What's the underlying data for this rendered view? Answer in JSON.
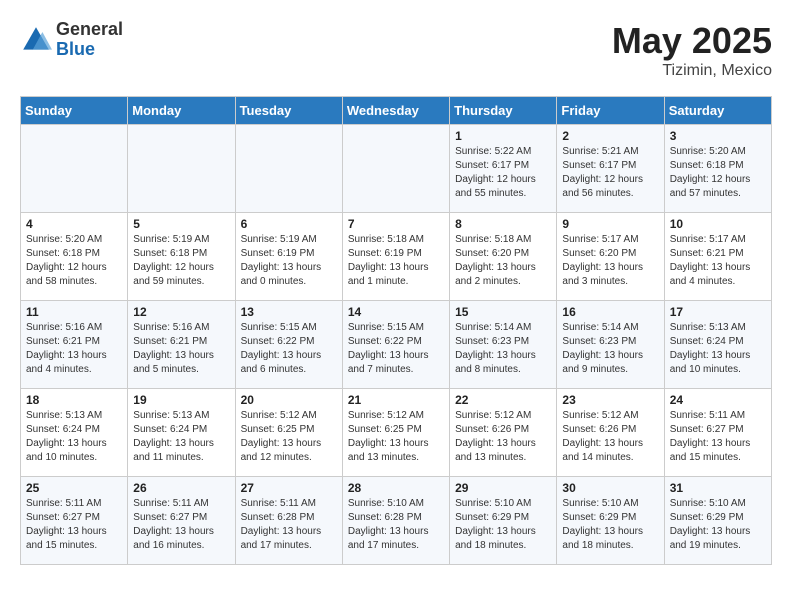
{
  "logo": {
    "general": "General",
    "blue": "Blue"
  },
  "title": "May 2025",
  "subtitle": "Tizimin, Mexico",
  "days_of_week": [
    "Sunday",
    "Monday",
    "Tuesday",
    "Wednesday",
    "Thursday",
    "Friday",
    "Saturday"
  ],
  "weeks": [
    [
      {
        "day": "",
        "info": ""
      },
      {
        "day": "",
        "info": ""
      },
      {
        "day": "",
        "info": ""
      },
      {
        "day": "",
        "info": ""
      },
      {
        "day": "1",
        "info": "Sunrise: 5:22 AM\nSunset: 6:17 PM\nDaylight: 12 hours\nand 55 minutes."
      },
      {
        "day": "2",
        "info": "Sunrise: 5:21 AM\nSunset: 6:17 PM\nDaylight: 12 hours\nand 56 minutes."
      },
      {
        "day": "3",
        "info": "Sunrise: 5:20 AM\nSunset: 6:18 PM\nDaylight: 12 hours\nand 57 minutes."
      }
    ],
    [
      {
        "day": "4",
        "info": "Sunrise: 5:20 AM\nSunset: 6:18 PM\nDaylight: 12 hours\nand 58 minutes."
      },
      {
        "day": "5",
        "info": "Sunrise: 5:19 AM\nSunset: 6:18 PM\nDaylight: 12 hours\nand 59 minutes."
      },
      {
        "day": "6",
        "info": "Sunrise: 5:19 AM\nSunset: 6:19 PM\nDaylight: 13 hours\nand 0 minutes."
      },
      {
        "day": "7",
        "info": "Sunrise: 5:18 AM\nSunset: 6:19 PM\nDaylight: 13 hours\nand 1 minute."
      },
      {
        "day": "8",
        "info": "Sunrise: 5:18 AM\nSunset: 6:20 PM\nDaylight: 13 hours\nand 2 minutes."
      },
      {
        "day": "9",
        "info": "Sunrise: 5:17 AM\nSunset: 6:20 PM\nDaylight: 13 hours\nand 3 minutes."
      },
      {
        "day": "10",
        "info": "Sunrise: 5:17 AM\nSunset: 6:21 PM\nDaylight: 13 hours\nand 4 minutes."
      }
    ],
    [
      {
        "day": "11",
        "info": "Sunrise: 5:16 AM\nSunset: 6:21 PM\nDaylight: 13 hours\nand 4 minutes."
      },
      {
        "day": "12",
        "info": "Sunrise: 5:16 AM\nSunset: 6:21 PM\nDaylight: 13 hours\nand 5 minutes."
      },
      {
        "day": "13",
        "info": "Sunrise: 5:15 AM\nSunset: 6:22 PM\nDaylight: 13 hours\nand 6 minutes."
      },
      {
        "day": "14",
        "info": "Sunrise: 5:15 AM\nSunset: 6:22 PM\nDaylight: 13 hours\nand 7 minutes."
      },
      {
        "day": "15",
        "info": "Sunrise: 5:14 AM\nSunset: 6:23 PM\nDaylight: 13 hours\nand 8 minutes."
      },
      {
        "day": "16",
        "info": "Sunrise: 5:14 AM\nSunset: 6:23 PM\nDaylight: 13 hours\nand 9 minutes."
      },
      {
        "day": "17",
        "info": "Sunrise: 5:13 AM\nSunset: 6:24 PM\nDaylight: 13 hours\nand 10 minutes."
      }
    ],
    [
      {
        "day": "18",
        "info": "Sunrise: 5:13 AM\nSunset: 6:24 PM\nDaylight: 13 hours\nand 10 minutes."
      },
      {
        "day": "19",
        "info": "Sunrise: 5:13 AM\nSunset: 6:24 PM\nDaylight: 13 hours\nand 11 minutes."
      },
      {
        "day": "20",
        "info": "Sunrise: 5:12 AM\nSunset: 6:25 PM\nDaylight: 13 hours\nand 12 minutes."
      },
      {
        "day": "21",
        "info": "Sunrise: 5:12 AM\nSunset: 6:25 PM\nDaylight: 13 hours\nand 13 minutes."
      },
      {
        "day": "22",
        "info": "Sunrise: 5:12 AM\nSunset: 6:26 PM\nDaylight: 13 hours\nand 13 minutes."
      },
      {
        "day": "23",
        "info": "Sunrise: 5:12 AM\nSunset: 6:26 PM\nDaylight: 13 hours\nand 14 minutes."
      },
      {
        "day": "24",
        "info": "Sunrise: 5:11 AM\nSunset: 6:27 PM\nDaylight: 13 hours\nand 15 minutes."
      }
    ],
    [
      {
        "day": "25",
        "info": "Sunrise: 5:11 AM\nSunset: 6:27 PM\nDaylight: 13 hours\nand 15 minutes."
      },
      {
        "day": "26",
        "info": "Sunrise: 5:11 AM\nSunset: 6:27 PM\nDaylight: 13 hours\nand 16 minutes."
      },
      {
        "day": "27",
        "info": "Sunrise: 5:11 AM\nSunset: 6:28 PM\nDaylight: 13 hours\nand 17 minutes."
      },
      {
        "day": "28",
        "info": "Sunrise: 5:10 AM\nSunset: 6:28 PM\nDaylight: 13 hours\nand 17 minutes."
      },
      {
        "day": "29",
        "info": "Sunrise: 5:10 AM\nSunset: 6:29 PM\nDaylight: 13 hours\nand 18 minutes."
      },
      {
        "day": "30",
        "info": "Sunrise: 5:10 AM\nSunset: 6:29 PM\nDaylight: 13 hours\nand 18 minutes."
      },
      {
        "day": "31",
        "info": "Sunrise: 5:10 AM\nSunset: 6:29 PM\nDaylight: 13 hours\nand 19 minutes."
      }
    ]
  ]
}
